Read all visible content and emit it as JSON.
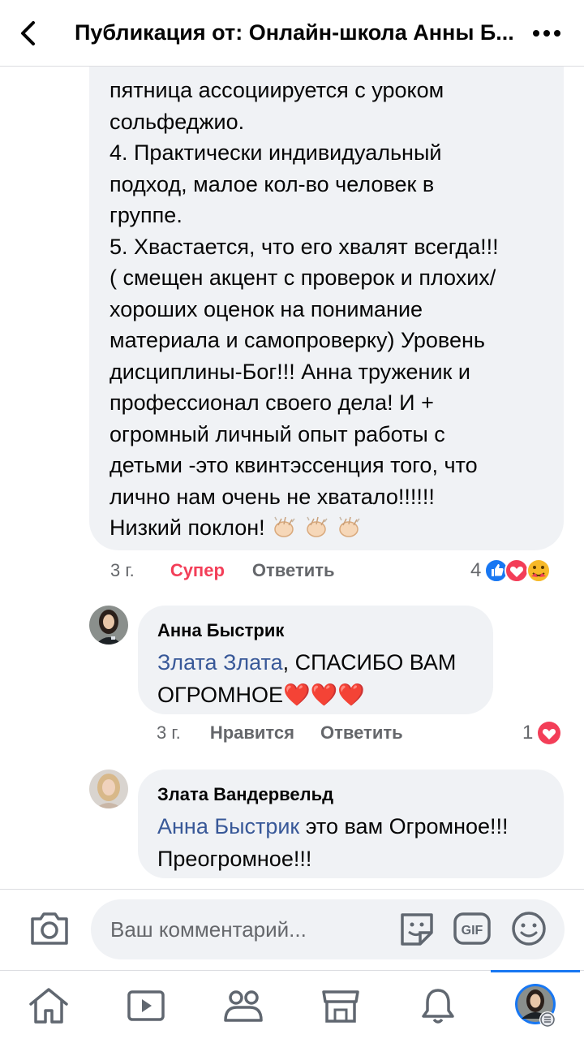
{
  "header": {
    "title": "Публикация от: Онлайн-школа Анны Б..."
  },
  "comment_main": {
    "text_lines": [
      "пятница ассоциируется с уроком",
      "сольфеджио.",
      "4. Практически индивидуальный",
      "подход, малое кол-во человек в",
      "группе.",
      "5. Хвастается, что его хвалят всегда!!!",
      "( смещен акцент с проверок и плохих/",
      "хороших оценок на понимание",
      "материала и самопроверку) Уровень",
      "дисциплины-Бог!!! Анна труженик и",
      "профессионал своего дела! И +",
      "огромный личный опыт работы с",
      "детьми -это квинтэссенция того, что",
      "лично нам очень не хватало!!!!!!",
      "Низкий поклон!"
    ],
    "time": "3 г.",
    "reaction_label": "Супер",
    "reply_label": "Ответить",
    "reaction_count": "4"
  },
  "reply1": {
    "author": "Анна Быстрик",
    "mention": "Злата Злата",
    "text_after_mention": ", СПАСИБО ВАМ",
    "text_line2": "ОГРОМНОЕ",
    "hearts": "❤️❤️❤️",
    "time": "3 г.",
    "like_label": "Нравится",
    "reply_label": "Ответить",
    "reaction_count": "1"
  },
  "reply2": {
    "author": "Злата Вандервельд",
    "mention": "Анна Быстрик",
    "text_after_mention": " это вам Огромное!!!",
    "text_line2": "Преогромное!!!"
  },
  "composer": {
    "placeholder": "Ваш комментарий..."
  },
  "colors": {
    "accent": "#1877f2",
    "love": "#f33e58",
    "mention": "#385898",
    "bubble": "#f0f2f5",
    "muted_text": "#65676b"
  },
  "icons": {
    "back": "chevron-left-icon",
    "more": "more-dots-icon",
    "camera": "camera-icon",
    "sticker": "sticker-icon",
    "gif": "gif-icon",
    "emoji": "emoji-icon",
    "tabs": [
      "home-icon",
      "video-icon",
      "groups-icon",
      "marketplace-icon",
      "bell-icon",
      "profile-menu-icon"
    ]
  }
}
